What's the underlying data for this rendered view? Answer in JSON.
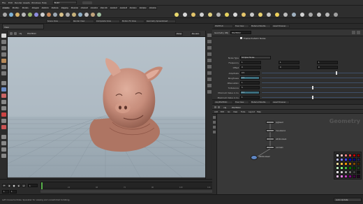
{
  "menu": [
    "File",
    "Edit",
    "Render",
    "Assets",
    "Windows",
    "Help"
  ],
  "desktop": "Build",
  "shelf_tabs": [
    "Create",
    "Modify",
    "Model",
    "Polygon",
    "Deform",
    "Texture",
    "Rigging",
    "Muscles",
    "Characters",
    "Constraints",
    "Hair Utils",
    "Guide Process",
    "Guide Brushes",
    "Terrain FX",
    "Simple FX",
    "Volume"
  ],
  "scene_tabs": [
    "Scene View",
    "Render View",
    "Composite View",
    "Motion FX View",
    "Geometry Spreadsheet"
  ],
  "viewport": {
    "tab": "View",
    "path": "obj",
    "node": "PIGHEAD",
    "view_label": "Persp",
    "cam_label": "No cam"
  },
  "parm_pane": {
    "tabs": [
      "PIGHEAD",
      "Tree View",
      "Material Palette",
      "Asset Browser"
    ],
    "node_type": "Geometry OBJ",
    "node_name": "PIGHEAD",
    "checkbox_label": "Enable Prefetch Nodes",
    "rows": [
      {
        "label": "Noise Type",
        "value": "Simplex Noise"
      },
      {
        "label": "Frequency",
        "value": "1"
      },
      {
        "label": "Offset",
        "value": "0"
      },
      {
        "label": "Amplitude",
        "value": "0.5"
      },
      {
        "label": "Roughness",
        "value": "0.5"
      },
      {
        "label": "Attenuation",
        "value": "1"
      },
      {
        "label": "Turbulence",
        "value": "5"
      },
      {
        "label": "Minimum Value in Cu",
        "value": "0.1"
      },
      {
        "label": "Maximum Value in Cu",
        "value": "1"
      }
    ]
  },
  "network": {
    "tabs": [
      "/obj/PIGHEAD",
      "Tree View",
      "Material Palette",
      "Asset Browser"
    ],
    "path_obj": "obj",
    "path_node": "PIGHEAD",
    "menu": [
      "Add",
      "Edit",
      "Go",
      "View",
      "Tools",
      "Layout",
      "Help"
    ],
    "context_label": "Geometry",
    "nodes": [
      {
        "label": "pighead"
      },
      {
        "label": "mountain1"
      },
      {
        "label": "attribnoise1"
      },
      {
        "label": "normal1"
      },
      {
        "label": "attribnoise2"
      }
    ],
    "selected_node": "attribnoise1"
  },
  "timeline": {
    "frame": "1",
    "start": "1",
    "end": "240",
    "ticks": [
      "24",
      "48",
      "72",
      "96",
      "120",
      "144",
      "168",
      "192",
      "216",
      "240"
    ],
    "end_frame_a": "240",
    "end_frame_b": "240"
  },
  "status": {
    "text": "Left mouse tumbles. Spacebar for viewing and unrestricted tumbling.",
    "auto_update": "Auto Update"
  },
  "colors": {
    "skin": "#c98f7d",
    "skin_dark": "#a26858",
    "skin_light": "#e0ad9c",
    "sky_top": "#b9c5cd",
    "grid": "#7d8c96",
    "slider_fill": "#3f4f68",
    "selected_node": "#5f86c3"
  },
  "swatch_colors": [
    "#ffffff",
    "#ffc0c0",
    "#ff8080",
    "#ff4040",
    "#c00000",
    "#800000",
    "#c0c0ff",
    "#8080ff",
    "#4040ff",
    "#0000c0",
    "#000080",
    "#202050",
    "#ffe0a0",
    "#ffc040",
    "#ff9900",
    "#c07000",
    "#804800",
    "#402400",
    "#c0ffc0",
    "#80ff80",
    "#40c040",
    "#008000",
    "#004000",
    "#204020",
    "#ffffff",
    "#d0d0d0",
    "#a0a0a0",
    "#707070",
    "#404040",
    "#101010",
    "#ffc0ff",
    "#ff80ff",
    "#c040c0",
    "#800080",
    "#400040",
    "#200020"
  ]
}
